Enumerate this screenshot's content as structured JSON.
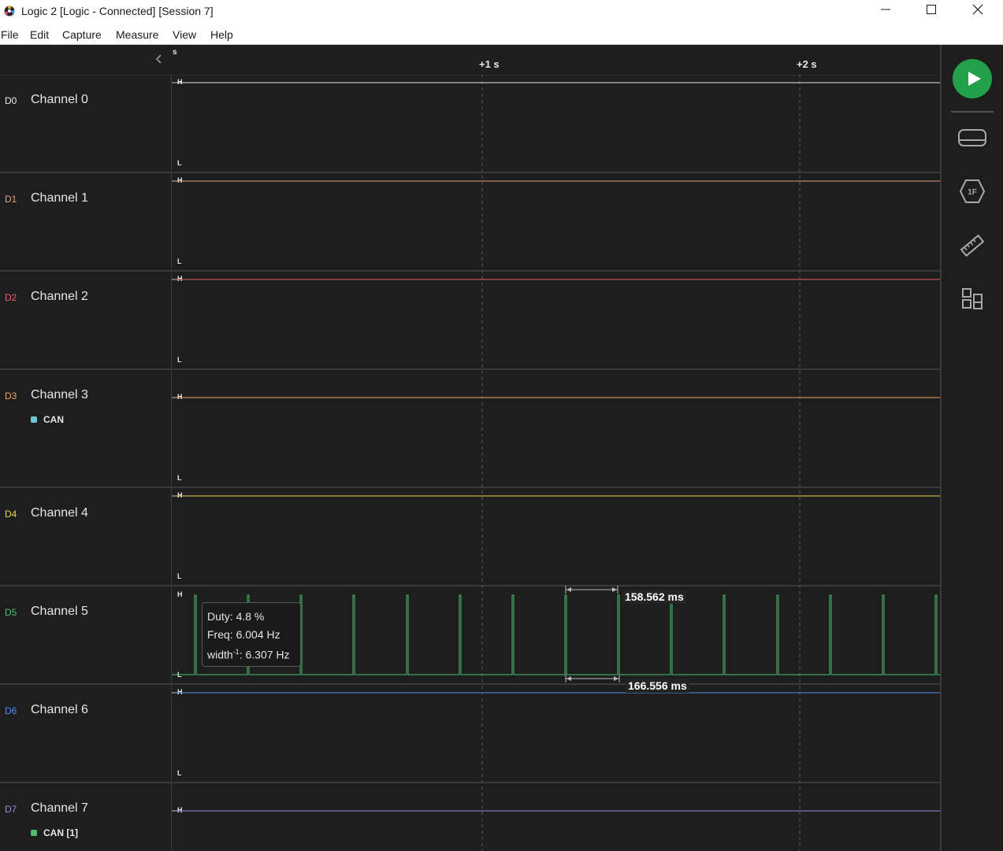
{
  "window": {
    "title": "Logic 2 [Logic - Connected] [Session 7]"
  },
  "menu": [
    "File",
    "Edit",
    "Capture",
    "Measure",
    "View",
    "Help"
  ],
  "timeline": {
    "unit": "s",
    "ticks": [
      "+1 s",
      "+2 s"
    ]
  },
  "channels": [
    {
      "dlabel": "D0",
      "name": "Channel 0",
      "color": "#e8e8e8",
      "high": "H",
      "low": "L"
    },
    {
      "dlabel": "D1",
      "name": "Channel 1",
      "color": "#e0a083",
      "high": "H",
      "low": "L"
    },
    {
      "dlabel": "D2",
      "name": "Channel 2",
      "color": "#ef5f6d",
      "high": "H",
      "low": "L"
    },
    {
      "dlabel": "D3",
      "name": "Channel 3",
      "color": "#f0a45e",
      "high": "H",
      "low": "L",
      "analyzer": "CAN",
      "analyzer_color": "#6fc6d8"
    },
    {
      "dlabel": "D4",
      "name": "Channel 4",
      "color": "#e8d44d",
      "high": "H",
      "low": "L"
    },
    {
      "dlabel": "D5",
      "name": "Channel 5",
      "color": "#4dbd6e",
      "high": "H",
      "low": "L"
    },
    {
      "dlabel": "D6",
      "name": "Channel 6",
      "color": "#4c8ff0",
      "high": "H",
      "low": "L"
    },
    {
      "dlabel": "D7",
      "name": "Channel 7",
      "color": "#a186e0",
      "high": "H",
      "analyzer": "CAN [1]",
      "analyzer_color": "#4dbd6e"
    }
  ],
  "measurements": {
    "pulse_period": "158.562 ms",
    "period": "166.556 ms"
  },
  "tooltip": {
    "duty": "Duty: 4.8 %",
    "freq": "Freq: 6.004 Hz",
    "width_prefix": "width",
    "width_exp": "-1",
    "width_value": ": 6.307 Hz"
  },
  "sidebar_icons": [
    "play-icon",
    "device-icon",
    "analyzers-icon",
    "measure-ruler-icon",
    "extensions-icon"
  ]
}
